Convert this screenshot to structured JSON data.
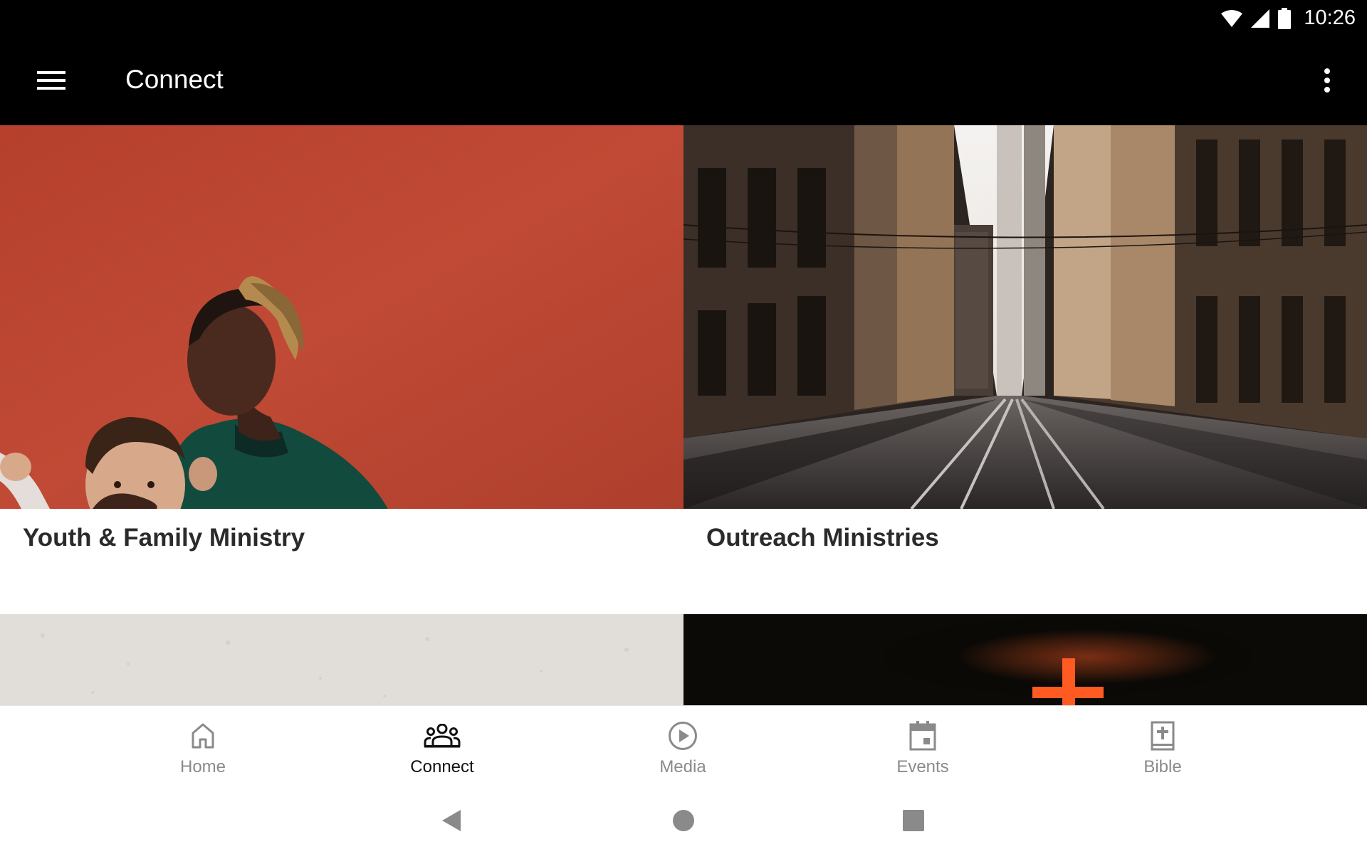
{
  "status_bar": {
    "time": "10:26",
    "icons": [
      "wifi-icon",
      "signal-icon",
      "battery-icon"
    ]
  },
  "app_bar": {
    "title": "Connect",
    "menu_icon": "hamburger-menu-icon",
    "overflow_icon": "more-vert-icon"
  },
  "cards": [
    {
      "title": "Youth & Family Ministry",
      "image": "father-and-baby-red-wall-photo"
    },
    {
      "title": "Outreach Ministries",
      "image": "city-street-photo"
    },
    {
      "title": "",
      "image": "concrete-texture-photo"
    },
    {
      "title": "",
      "image": "glowing-cross-photo"
    }
  ],
  "bottom_nav": {
    "items": [
      {
        "label": "Home",
        "icon": "home-icon",
        "active": false
      },
      {
        "label": "Connect",
        "icon": "groups-icon",
        "active": true
      },
      {
        "label": "Media",
        "icon": "play-circle-icon",
        "active": false
      },
      {
        "label": "Events",
        "icon": "calendar-icon",
        "active": false
      },
      {
        "label": "Bible",
        "icon": "bible-icon",
        "active": false
      }
    ]
  },
  "system_nav": {
    "buttons": [
      "back-icon",
      "home-circle-icon",
      "recents-icon"
    ]
  },
  "colors": {
    "bar_background": "#000000",
    "active_nav": "#111111",
    "inactive_nav": "#8a8a8a",
    "card_title": "#2b2b2b"
  }
}
